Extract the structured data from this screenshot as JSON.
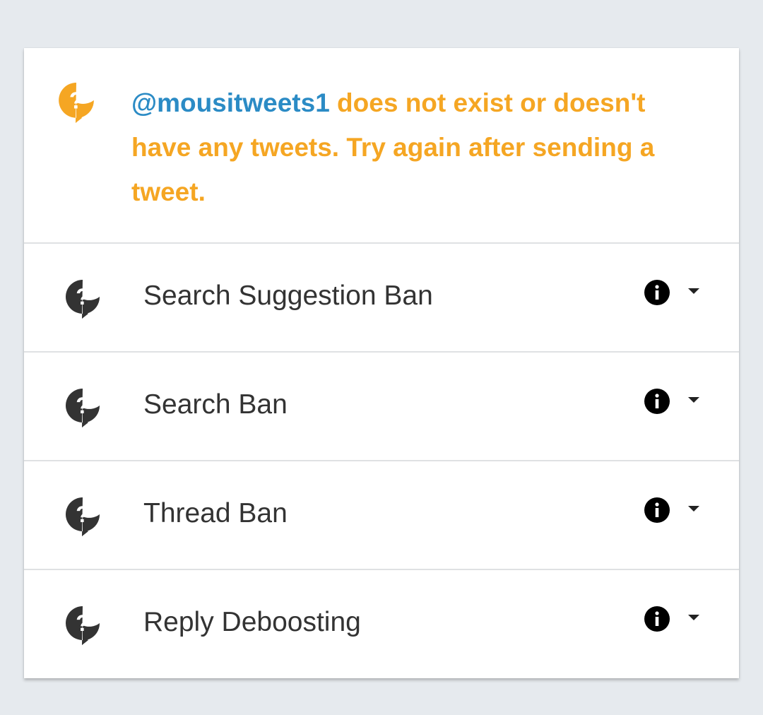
{
  "colors": {
    "page_background": "#e6eaee",
    "warning_orange": "#f5a623",
    "handle_blue": "#2b8bc5",
    "label_text": "#333333",
    "icon_dark": "#333333"
  },
  "status": {
    "icon": "question-bubble-icon",
    "handle": "@mousitweets1",
    "message": " does not exist or doesn't have any tweets. Try again after sending a tweet."
  },
  "checks": [
    {
      "label": "Search Suggestion Ban",
      "status_icon": "question-bubble-icon",
      "info_icon": "info-icon",
      "expand_icon": "caret-down-icon"
    },
    {
      "label": "Search Ban",
      "status_icon": "question-bubble-icon",
      "info_icon": "info-icon",
      "expand_icon": "caret-down-icon"
    },
    {
      "label": "Thread Ban",
      "status_icon": "question-bubble-icon",
      "info_icon": "info-icon",
      "expand_icon": "caret-down-icon"
    },
    {
      "label": "Reply Deboosting",
      "status_icon": "question-bubble-icon",
      "info_icon": "info-icon",
      "expand_icon": "caret-down-icon"
    }
  ]
}
